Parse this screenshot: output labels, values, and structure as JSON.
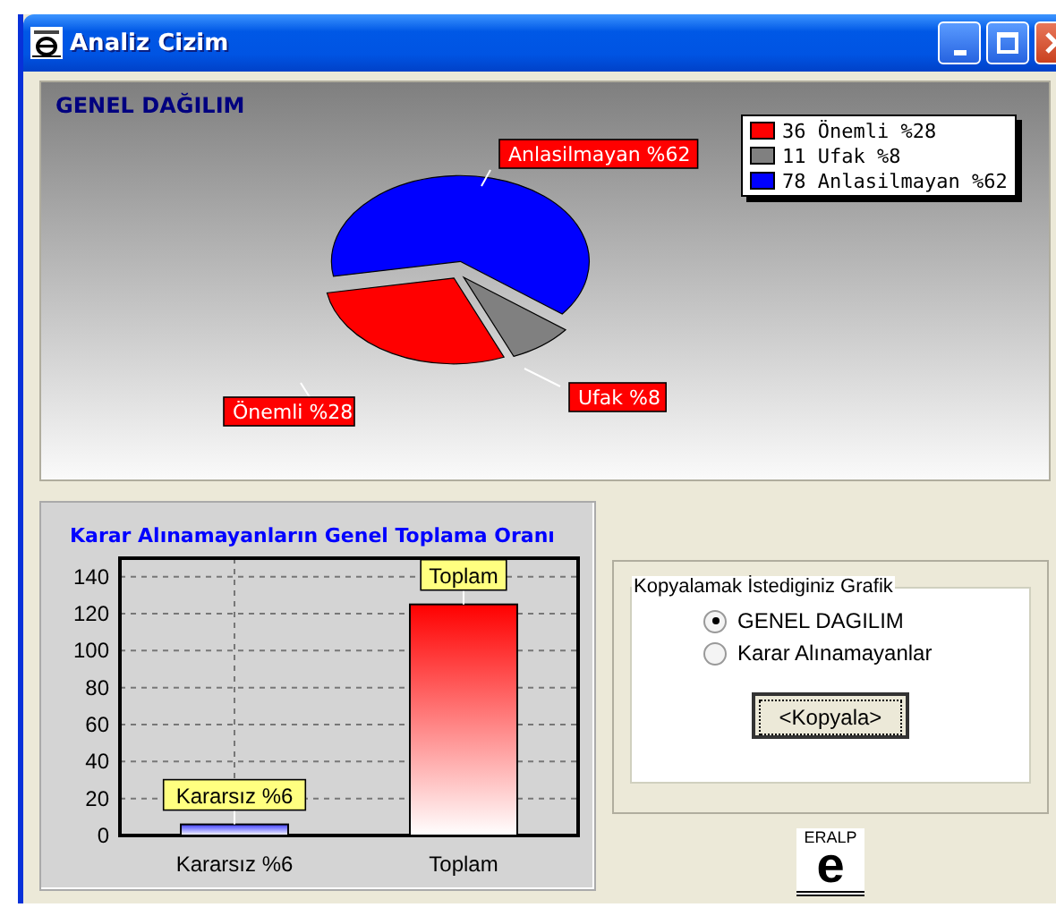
{
  "window": {
    "title": "Analiz Cizim"
  },
  "pie_panel": {
    "title": "GENEL DAĞILIM",
    "chart_data": {
      "type": "pie",
      "categories": [
        "Önemli %28",
        "Ufak %8",
        "Anlasilmayan %62"
      ],
      "values": [
        28,
        8,
        62
      ]
    },
    "legend": [
      {
        "label": "36 Önemli %28",
        "color": "#ff0000"
      },
      {
        "label": "11 Ufak %8",
        "color": "#808080"
      },
      {
        "label": "78 Anlasilmayan %62",
        "color": "#0000ff"
      }
    ]
  },
  "bar_panel": {
    "chart_data": {
      "type": "bar",
      "title": "Karar Alınamayanların Genel Toplama Oranı",
      "categories": [
        "Kararsız %6",
        "Toplam"
      ],
      "values": [
        6,
        125
      ],
      "ylim": [
        0,
        150
      ],
      "yticks": [
        0,
        20,
        40,
        60,
        80,
        100,
        120,
        140
      ],
      "grid": true,
      "value_labels": [
        "Kararsız %6",
        "Toplam"
      ]
    }
  },
  "copy_group": {
    "title": "Kopyalamak İstediginiz Grafik",
    "options": [
      {
        "label": "GENEL DAGILIM",
        "selected": true
      },
      {
        "label": "Karar Alınamayanlar",
        "selected": false
      }
    ],
    "button": "<Kopyala>"
  },
  "logo": {
    "top": "ERALP",
    "letter": "e"
  }
}
